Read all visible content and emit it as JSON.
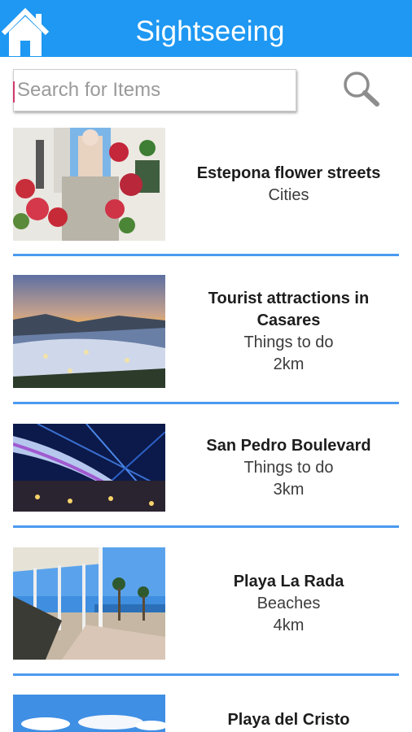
{
  "header": {
    "title": "Sightseeing",
    "home_icon": "home-icon",
    "bar_color": "#1E98F2"
  },
  "search": {
    "placeholder": "Search for Items",
    "value": "",
    "icon": "search-icon"
  },
  "items": [
    {
      "title": "Estepona flower streets",
      "category": "Cities",
      "distance": ""
    },
    {
      "title": "Tourist attractions in Casares",
      "category": "Things to do",
      "distance": "2km"
    },
    {
      "title": "San Pedro Boulevard",
      "category": "Things to do",
      "distance": "3km"
    },
    {
      "title": "Playa La Rada",
      "category": "Beaches",
      "distance": "4km"
    },
    {
      "title": "Playa del Cristo",
      "category": "",
      "distance": ""
    }
  ],
  "divider_color": "#4B9AF0"
}
